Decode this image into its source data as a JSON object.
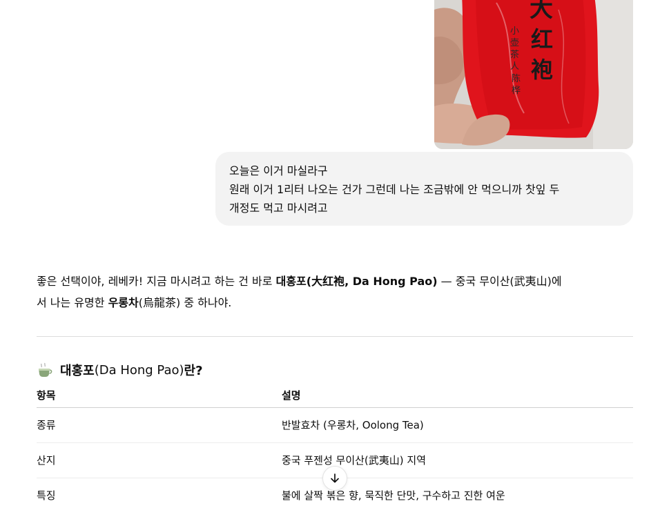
{
  "user_message": {
    "image_label": {
      "brand_text": "大红袍",
      "side_text": "小壶茶人陈桦超"
    },
    "lines": [
      "오늘은 이거 마실라구",
      "원래 이거 1리터 나오는 건가 그런데 나는 조금밖에 안 먹으니까 찻잎 두",
      "개정도 먹고 마시려고"
    ]
  },
  "assistant": {
    "intro": {
      "part1": "좋은 선택이야, 레베카! 지금 마시려고 하는 건 바로 ",
      "bold1": "대홍포(大红袍, Da Hong Pao)",
      "part2": " — 중국 무이산(武夷山)에",
      "part3": "서 나는 유명한 ",
      "bold2": "우롱차",
      "bold2_paren": "(烏龍茶)",
      "part4": " 중 하나야."
    },
    "section": {
      "icon": "tea-cup-icon",
      "title_bold": "대홍포",
      "title_paren": " (Da Hong Pao)",
      "title_end": "란?"
    },
    "table": {
      "headers": [
        "항목",
        "설명"
      ],
      "rows": [
        [
          "종류",
          "반발효차 (우롱차, Oolong Tea)"
        ],
        [
          "산지",
          "중국 푸젠성 무이산(武夷山) 지역"
        ],
        [
          "특징",
          "불에 살짝 볶은 향, 묵직한 단맛, 구수하고 진한 여운"
        ]
      ]
    }
  },
  "controls": {
    "scroll_down_icon": "arrow-down-icon"
  },
  "colors": {
    "bubble_bg": "#f3f3f3",
    "tea_package_red": "#e0141c",
    "divider": "#dcdcdc"
  }
}
